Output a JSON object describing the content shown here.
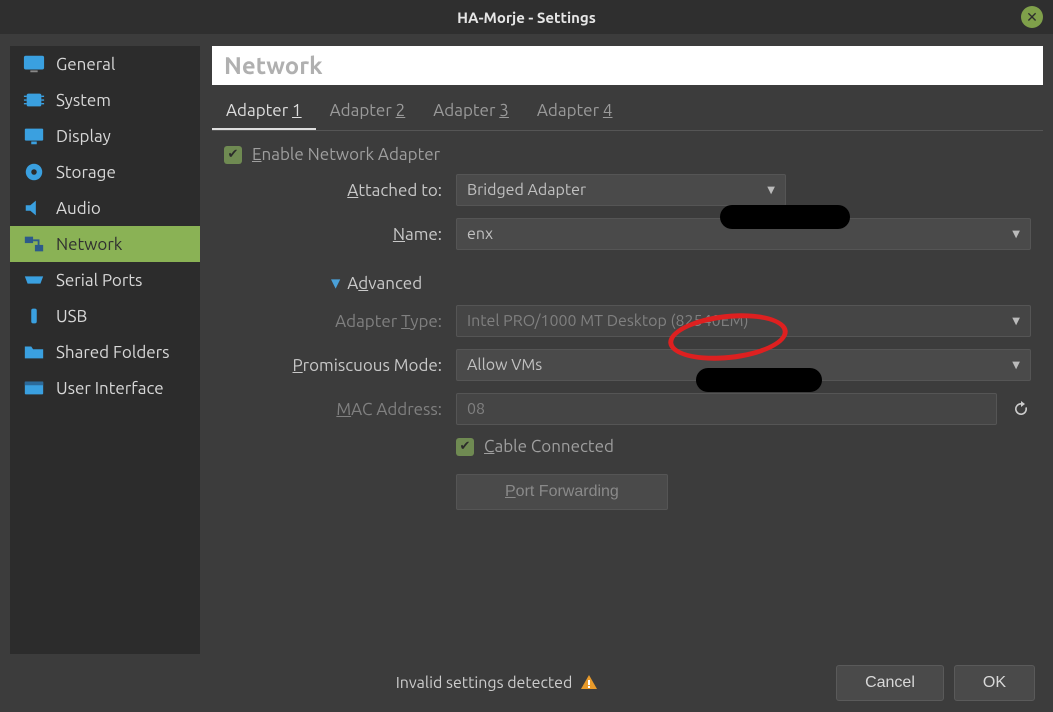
{
  "title": "HA-Morje - Settings",
  "sidebar": {
    "items": [
      {
        "label": "General"
      },
      {
        "label": "System"
      },
      {
        "label": "Display"
      },
      {
        "label": "Storage"
      },
      {
        "label": "Audio"
      },
      {
        "label": "Network"
      },
      {
        "label": "Serial Ports"
      },
      {
        "label": "USB"
      },
      {
        "label": "Shared Folders"
      },
      {
        "label": "User Interface"
      }
    ],
    "active_index": 5
  },
  "header": "Network",
  "tabs": [
    {
      "label": "Adapter ",
      "num": "1",
      "active": true
    },
    {
      "label": "Adapter ",
      "num": "2",
      "active": false
    },
    {
      "label": "Adapter ",
      "num": "3",
      "active": false
    },
    {
      "label": "Adapter ",
      "num": "4",
      "active": false
    }
  ],
  "enable_adapter": {
    "label": "Enable Network Adapter",
    "checked": true
  },
  "fields": {
    "attached_to": {
      "label": "Attached to:",
      "value": "Bridged Adapter"
    },
    "name": {
      "label": "Name:",
      "value": "enx"
    },
    "advanced": "Advanced",
    "adapter_type": {
      "label": "Adapter Type:",
      "value": "Intel PRO/1000 MT Desktop (82540EM)"
    },
    "promiscuous": {
      "label": "Promiscuous Mode:",
      "value": "Allow VMs"
    },
    "mac": {
      "label": "MAC Address:",
      "value": "08"
    },
    "cable": {
      "label": "Cable Connected",
      "checked": true
    },
    "port_forwarding": "Port Forwarding"
  },
  "status": "Invalid settings detected",
  "buttons": {
    "cancel": "Cancel",
    "ok": "OK"
  }
}
